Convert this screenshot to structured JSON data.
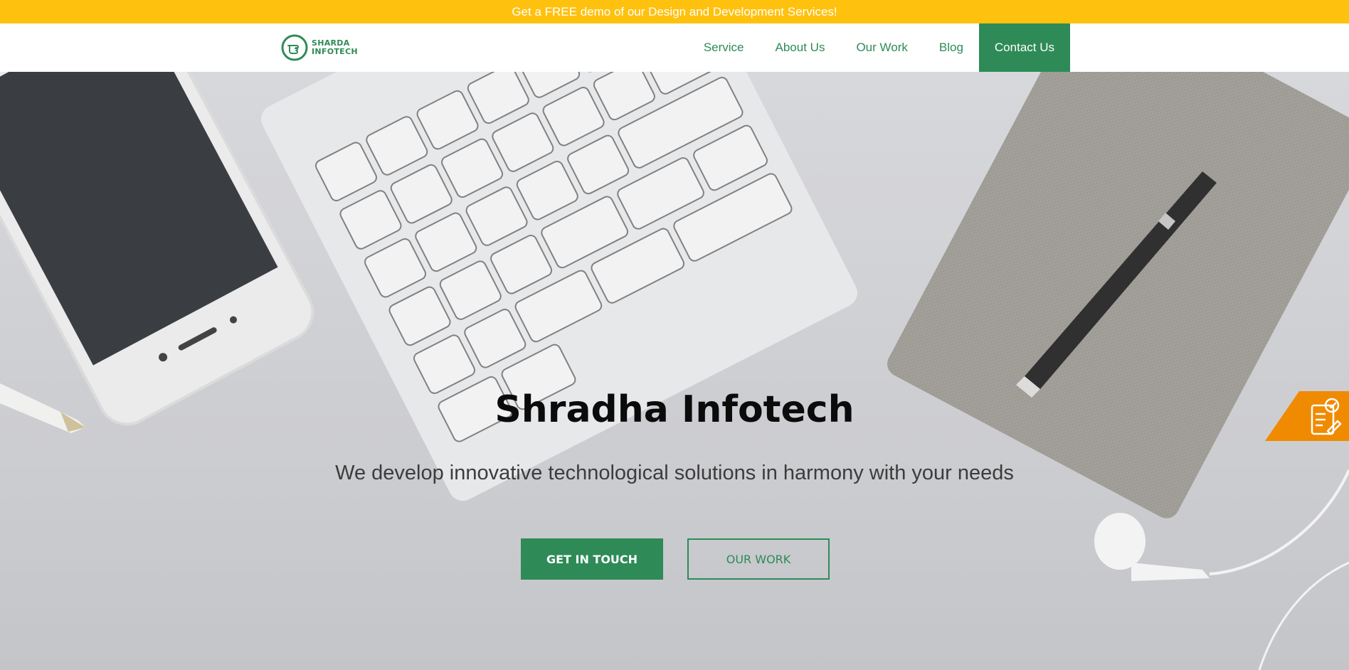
{
  "promo": {
    "text": "Get a FREE demo of our Design and Development Services!"
  },
  "brand": {
    "line1": "SHARDA",
    "line2": "INFOTECH",
    "logo_icon": "pointing-hand-icon"
  },
  "nav": {
    "items": [
      {
        "label": "Service"
      },
      {
        "label": "About Us"
      },
      {
        "label": "Our Work"
      },
      {
        "label": "Blog"
      }
    ],
    "cta_label": "Contact Us"
  },
  "hero": {
    "title": "Shradha Infotech",
    "subtitle": "We develop innovative technological solutions in harmony with your needs",
    "primary_button": "GET IN TOUCH",
    "secondary_button": "OUR WORK"
  },
  "side_badge": {
    "icon": "quote-checklist-icon"
  },
  "colors": {
    "promo_bg": "#fec10e",
    "brand_green": "#2e8b57",
    "badge_orange": "#f08a00",
    "hero_bg": "#c9cace"
  }
}
